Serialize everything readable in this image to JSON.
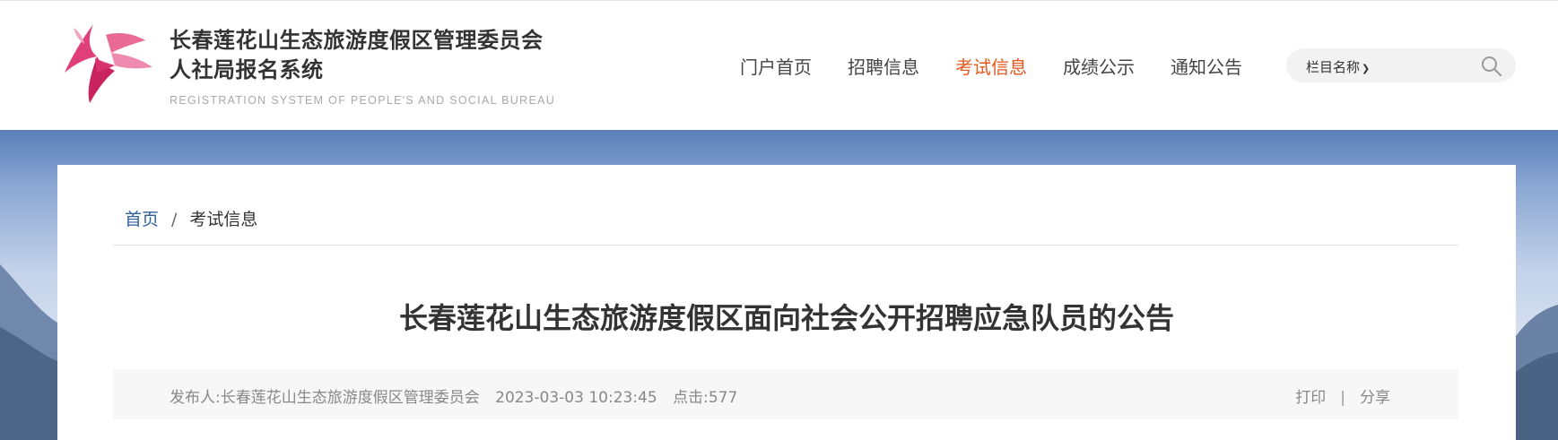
{
  "header": {
    "title_line1": "长春莲花山生态旅游度假区管理委员会",
    "title_line2": "人社局报名系统",
    "subtitle_en": "REGISTRATION SYSTEM OF PEOPLE'S AND SOCIAL BUREAU",
    "logo_icon": "lotus-logo-icon"
  },
  "nav": {
    "items": [
      {
        "label": "门户首页",
        "active": false
      },
      {
        "label": "招聘信息",
        "active": false
      },
      {
        "label": "考试信息",
        "active": true
      },
      {
        "label": "成绩公示",
        "active": false
      },
      {
        "label": "通知公告",
        "active": false
      }
    ],
    "active_color": "#e4571f"
  },
  "search": {
    "select_label": "栏目名称",
    "select_icon": "chevron-down-icon",
    "placeholder": "",
    "button_icon": "search-icon"
  },
  "breadcrumb": {
    "home": "首页",
    "separator": "/",
    "current": "考试信息"
  },
  "article": {
    "title": "长春莲花山生态旅游度假区面向社会公开招聘应急队员的公告",
    "publisher": "发布人:长春莲花山生态旅游度假区管理委员会",
    "datetime": "2023-03-03 10:23:45",
    "clicks": "点击:577",
    "print_label": "打印",
    "divider_char": "|",
    "share_label": "分享"
  }
}
